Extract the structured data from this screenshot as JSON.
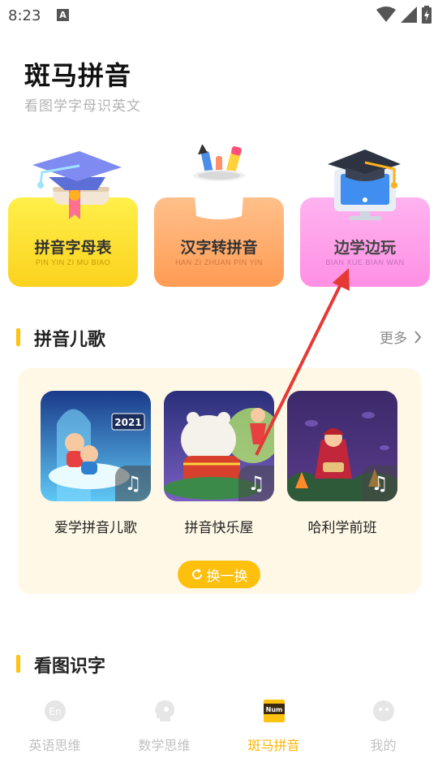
{
  "status_bar": {
    "time": "8:23",
    "notification_icon": "A"
  },
  "header": {
    "title": "斑马拼音",
    "subtitle": "看图学字母识英文"
  },
  "features": [
    {
      "label": "拼音字母表",
      "sub": "PIN YIN ZI MU BIAO",
      "icon": "graduation-cap-icon"
    },
    {
      "label": "汉字转拼音",
      "sub": "HAN ZI ZHUAN PIN YIN",
      "icon": "pencil-cup-icon"
    },
    {
      "label": "边学边玩",
      "sub": "BIAN XUE BIAN WAN",
      "icon": "computer-cap-icon"
    }
  ],
  "songs_section": {
    "title": "拼音儿歌",
    "more": "更多"
  },
  "songs": [
    {
      "name": "爱学拼音儿歌",
      "year": "2021"
    },
    {
      "name": "拼音快乐屋"
    },
    {
      "name": "哈利学前班"
    }
  ],
  "refresh_label": "换一换",
  "picture_section": {
    "title": "看图识字"
  },
  "nav": [
    {
      "label": "英语思维",
      "icon": "english-icon",
      "icon_text": "En"
    },
    {
      "label": "数学思维",
      "icon": "math-head-icon"
    },
    {
      "label": "斑马拼音",
      "icon": "num-book-icon",
      "icon_text": "Num"
    },
    {
      "label": "我的",
      "icon": "profile-icon"
    }
  ],
  "colors": {
    "accent": "#ffbf0d",
    "annotation_arrow": "#e53935"
  }
}
